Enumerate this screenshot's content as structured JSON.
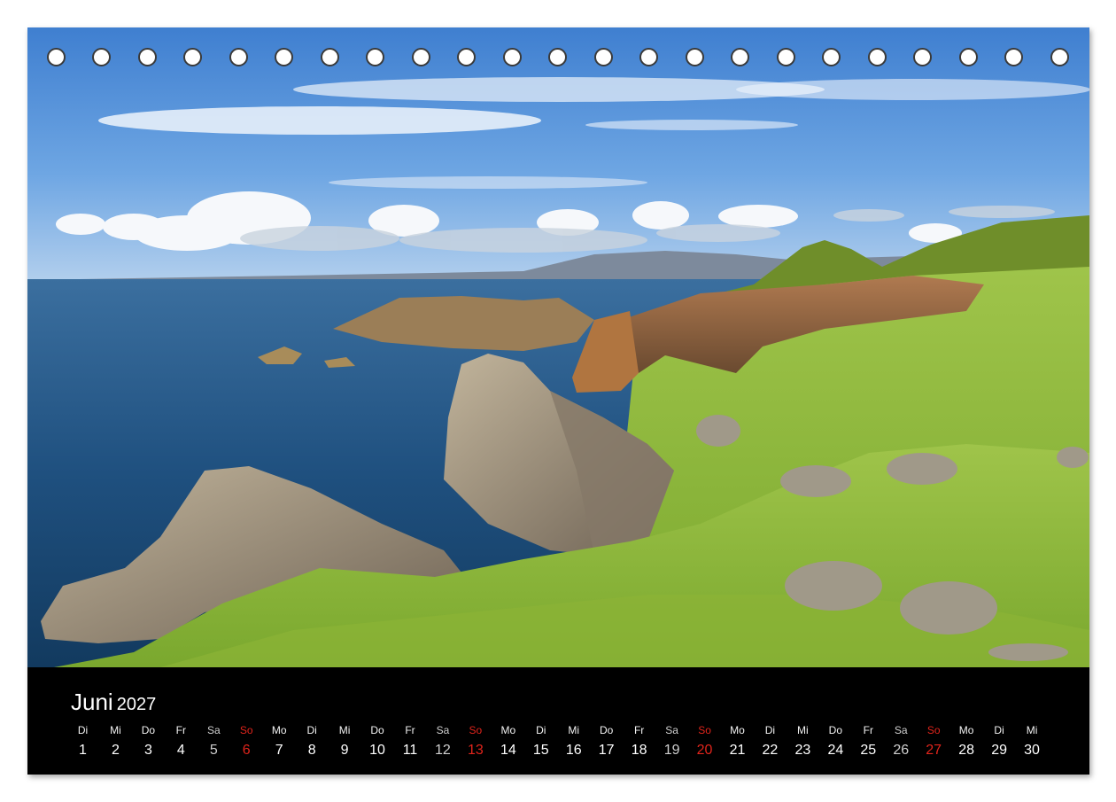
{
  "calendar": {
    "month": "Juni",
    "year": "2027",
    "days": [
      {
        "wd": "Di",
        "n": "1"
      },
      {
        "wd": "Mi",
        "n": "2"
      },
      {
        "wd": "Do",
        "n": "3"
      },
      {
        "wd": "Fr",
        "n": "4"
      },
      {
        "wd": "Sa",
        "n": "5"
      },
      {
        "wd": "So",
        "n": "6"
      },
      {
        "wd": "Mo",
        "n": "7"
      },
      {
        "wd": "Di",
        "n": "8"
      },
      {
        "wd": "Mi",
        "n": "9"
      },
      {
        "wd": "Do",
        "n": "10"
      },
      {
        "wd": "Fr",
        "n": "11"
      },
      {
        "wd": "Sa",
        "n": "12"
      },
      {
        "wd": "So",
        "n": "13"
      },
      {
        "wd": "Mo",
        "n": "14"
      },
      {
        "wd": "Di",
        "n": "15"
      },
      {
        "wd": "Mi",
        "n": "16"
      },
      {
        "wd": "Do",
        "n": "17"
      },
      {
        "wd": "Fr",
        "n": "18"
      },
      {
        "wd": "Sa",
        "n": "19"
      },
      {
        "wd": "So",
        "n": "20"
      },
      {
        "wd": "Mo",
        "n": "21"
      },
      {
        "wd": "Di",
        "n": "22"
      },
      {
        "wd": "Mi",
        "n": "23"
      },
      {
        "wd": "Do",
        "n": "24"
      },
      {
        "wd": "Fr",
        "n": "25"
      },
      {
        "wd": "Sa",
        "n": "26"
      },
      {
        "wd": "So",
        "n": "27"
      },
      {
        "wd": "Mo",
        "n": "28"
      },
      {
        "wd": "Di",
        "n": "29"
      },
      {
        "wd": "Mi",
        "n": "30"
      }
    ]
  },
  "colors": {
    "sunday": "#e0241b",
    "sky": "#4f8ed8",
    "sea": "#1d4f7d",
    "grass": "#86b533"
  }
}
